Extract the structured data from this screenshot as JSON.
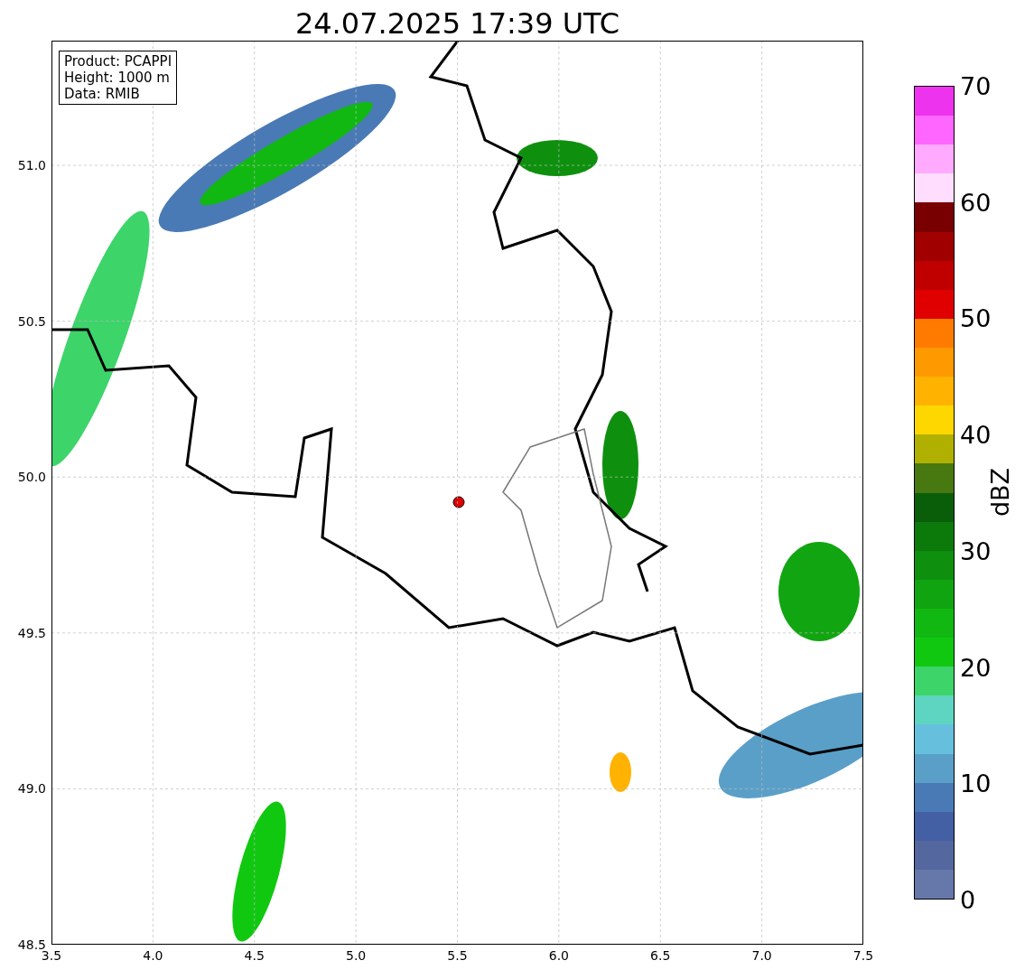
{
  "title": "24.07.2025 17:39 UTC",
  "info_box": [
    "Product: PCAPPI",
    "Height: 1000 m",
    "Data: RMIB"
  ],
  "x_ticks": [
    "3.5",
    "4.0",
    "4.5",
    "5.0",
    "5.5",
    "6.0",
    "6.5",
    "7.0",
    "7.5"
  ],
  "y_ticks": [
    "51.0",
    "50.5",
    "50.0",
    "49.5",
    "49.0",
    "48.5"
  ],
  "colorbar": {
    "label": "dBZ",
    "ticks": [
      "70",
      "60",
      "50",
      "40",
      "30",
      "20",
      "10",
      "0"
    ],
    "bands": [
      {
        "color": "#ee33ee"
      },
      {
        "color": "#ff66ff"
      },
      {
        "color": "#ffaaff"
      },
      {
        "color": "#ffddff"
      },
      {
        "color": "#780000"
      },
      {
        "color": "#a00000"
      },
      {
        "color": "#c00000"
      },
      {
        "color": "#e00000"
      },
      {
        "color": "#ff7b00"
      },
      {
        "color": "#ff9900"
      },
      {
        "color": "#ffb300"
      },
      {
        "color": "#ffd700"
      },
      {
        "color": "#b0b000"
      },
      {
        "color": "#487810"
      },
      {
        "color": "#0a5e0a"
      },
      {
        "color": "#0b7a0b"
      },
      {
        "color": "#0e900e"
      },
      {
        "color": "#10a510"
      },
      {
        "color": "#11b811"
      },
      {
        "color": "#11c811"
      },
      {
        "color": "#3dd46a"
      },
      {
        "color": "#5dd5c0"
      },
      {
        "color": "#66c0dd"
      },
      {
        "color": "#5a9fc8"
      },
      {
        "color": "#4a7ab5"
      },
      {
        "color": "#4460a5"
      },
      {
        "color": "#55679f"
      },
      {
        "color": "#6677aa"
      }
    ]
  }
}
